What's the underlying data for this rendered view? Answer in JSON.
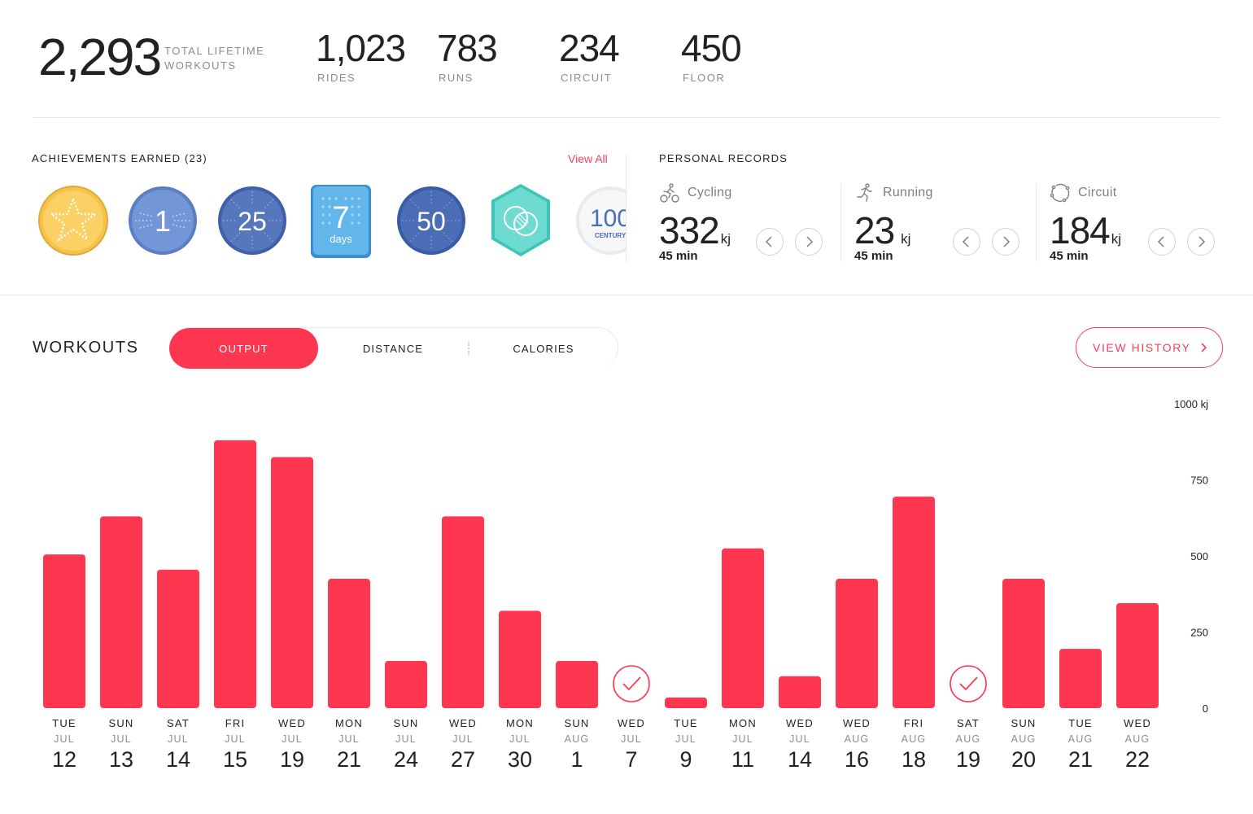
{
  "summary": {
    "total": "2,293",
    "total_label": "TOTAL LIFETIME WORKOUTS",
    "stats": [
      {
        "value": "1,023",
        "label": "RIDES"
      },
      {
        "value": "783",
        "label": "RUNS"
      },
      {
        "value": "234",
        "label": "CIRCUIT"
      },
      {
        "value": "450",
        "label": "FLOOR"
      }
    ]
  },
  "achievements": {
    "title": "ACHIEVEMENTS EARNED (23)",
    "view_all": "View All",
    "badges": [
      {
        "name": "star-badge",
        "text": "",
        "color": "#f7c24a"
      },
      {
        "name": "one-badge",
        "text": "1",
        "color": "#6b8fcf"
      },
      {
        "name": "twenty-five-badge",
        "text": "25",
        "color": "#5677bd"
      },
      {
        "name": "seven-days-badge",
        "text": "7",
        "subtext": "days",
        "color": "#5aaee0"
      },
      {
        "name": "fifty-badge",
        "text": "50",
        "color": "#4a6db6"
      },
      {
        "name": "hexagon-badge",
        "text": "",
        "color": "#5fd3c7"
      },
      {
        "name": "century-badge",
        "text": "100",
        "subtext": "CENTURY",
        "color": "#f1f2f4"
      }
    ]
  },
  "personal_records": {
    "title": "PERSONAL RECORDS",
    "items": [
      {
        "name": "Cycling",
        "icon": "cycling-icon",
        "value": "332",
        "unit": "kj",
        "duration": "45 min"
      },
      {
        "name": "Running",
        "icon": "running-icon",
        "value": "23",
        "unit": "kj",
        "duration": "45 min"
      },
      {
        "name": "Circuit",
        "icon": "circuit-icon",
        "value": "184",
        "unit": "kj",
        "duration": "45 min"
      }
    ]
  },
  "workouts": {
    "title": "WORKOUTS",
    "tabs": [
      {
        "label": "OUTPUT",
        "active": true
      },
      {
        "label": "DISTANCE",
        "active": false
      },
      {
        "label": "CALORIES",
        "active": false
      }
    ],
    "view_history": "VIEW HISTORY"
  },
  "colors": {
    "accent": "#ff3650",
    "accent_text": "#f43f5e",
    "muted_text": "#8a8d91",
    "divider": "#e6e7e9"
  },
  "chart_data": {
    "type": "bar",
    "title": "",
    "xlabel": "",
    "ylabel": "",
    "ylim": [
      0,
      1000
    ],
    "y_ticks": [
      {
        "value": 0,
        "label": "0"
      },
      {
        "value": 250,
        "label": "250"
      },
      {
        "value": 500,
        "label": "500"
      },
      {
        "value": 750,
        "label": "750"
      },
      {
        "value": 1000,
        "label": "1000 kj"
      }
    ],
    "categories": [
      {
        "day": "TUE",
        "month": "JUL",
        "date": "12",
        "value": 505
      },
      {
        "day": "SUN",
        "month": "JUL",
        "date": "13",
        "value": 630
      },
      {
        "day": "SAT",
        "month": "JUL",
        "date": "14",
        "value": 455
      },
      {
        "day": "FRI",
        "month": "JUL",
        "date": "15",
        "value": 880
      },
      {
        "day": "WED",
        "month": "JUL",
        "date": "19",
        "value": 825
      },
      {
        "day": "MON",
        "month": "JUL",
        "date": "21",
        "value": 425
      },
      {
        "day": "SUN",
        "month": "JUL",
        "date": "24",
        "value": 155
      },
      {
        "day": "WED",
        "month": "JUL",
        "date": "27",
        "value": 630
      },
      {
        "day": "MON",
        "month": "JUL",
        "date": "30",
        "value": 320
      },
      {
        "day": "SUN",
        "month": "AUG",
        "date": "1",
        "value": 155
      },
      {
        "day": "WED",
        "month": "JUL",
        "date": "7",
        "value": null,
        "completed_marker": true
      },
      {
        "day": "TUE",
        "month": "JUL",
        "date": "9",
        "value": 35
      },
      {
        "day": "MON",
        "month": "JUL",
        "date": "11",
        "value": 525
      },
      {
        "day": "WED",
        "month": "JUL",
        "date": "14",
        "value": 105
      },
      {
        "day": "WED",
        "month": "AUG",
        "date": "16",
        "value": 425
      },
      {
        "day": "FRI",
        "month": "AUG",
        "date": "18",
        "value": 695
      },
      {
        "day": "SAT",
        "month": "AUG",
        "date": "19",
        "value": null,
        "completed_marker": true
      },
      {
        "day": "SUN",
        "month": "AUG",
        "date": "20",
        "value": 425
      },
      {
        "day": "TUE",
        "month": "AUG",
        "date": "21",
        "value": 195
      },
      {
        "day": "WED",
        "month": "AUG",
        "date": "22",
        "value": 345
      }
    ]
  }
}
